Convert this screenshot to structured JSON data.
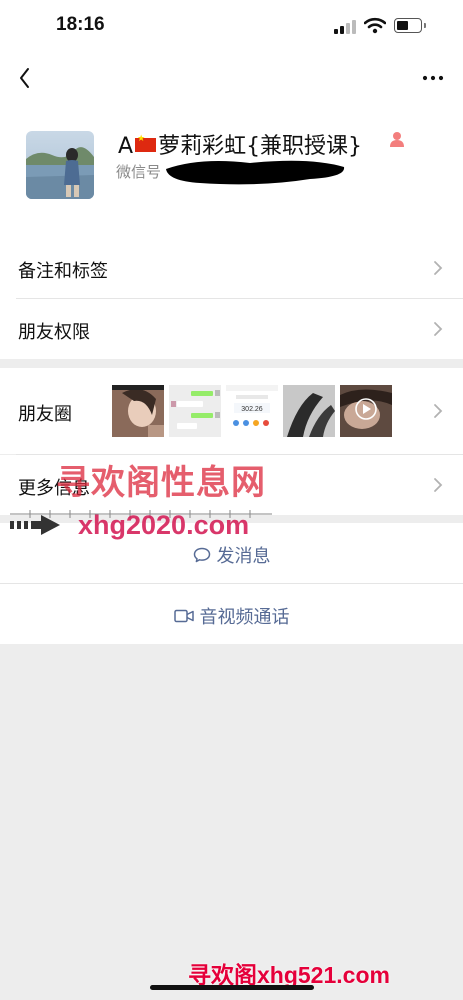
{
  "status_bar": {
    "time": "18:16"
  },
  "contact": {
    "nickname_prefix": "A",
    "nickname_main": "萝莉彩虹{兼职授课}",
    "wechat_id_label": "微信号"
  },
  "menu": {
    "remark": "备注和标签",
    "permissions": "朋友权限",
    "moments": "朋友圈",
    "more_info": "更多信息"
  },
  "moments_thumbs": [
    {
      "type": "photo"
    },
    {
      "type": "chat-screenshot"
    },
    {
      "type": "payment-screenshot",
      "amount": "302.26"
    },
    {
      "type": "photo"
    },
    {
      "type": "video"
    }
  ],
  "actions": {
    "send_message": "发消息",
    "video_call": "音视频通话"
  },
  "watermarks": {
    "line1": "寻欢阁性息网",
    "line2": "xhg2020.com",
    "footer": "寻欢阁xhg521.com"
  },
  "colors": {
    "link_blue": "#576b95",
    "gender_female": "#f37e7d",
    "background": "#ededed"
  }
}
